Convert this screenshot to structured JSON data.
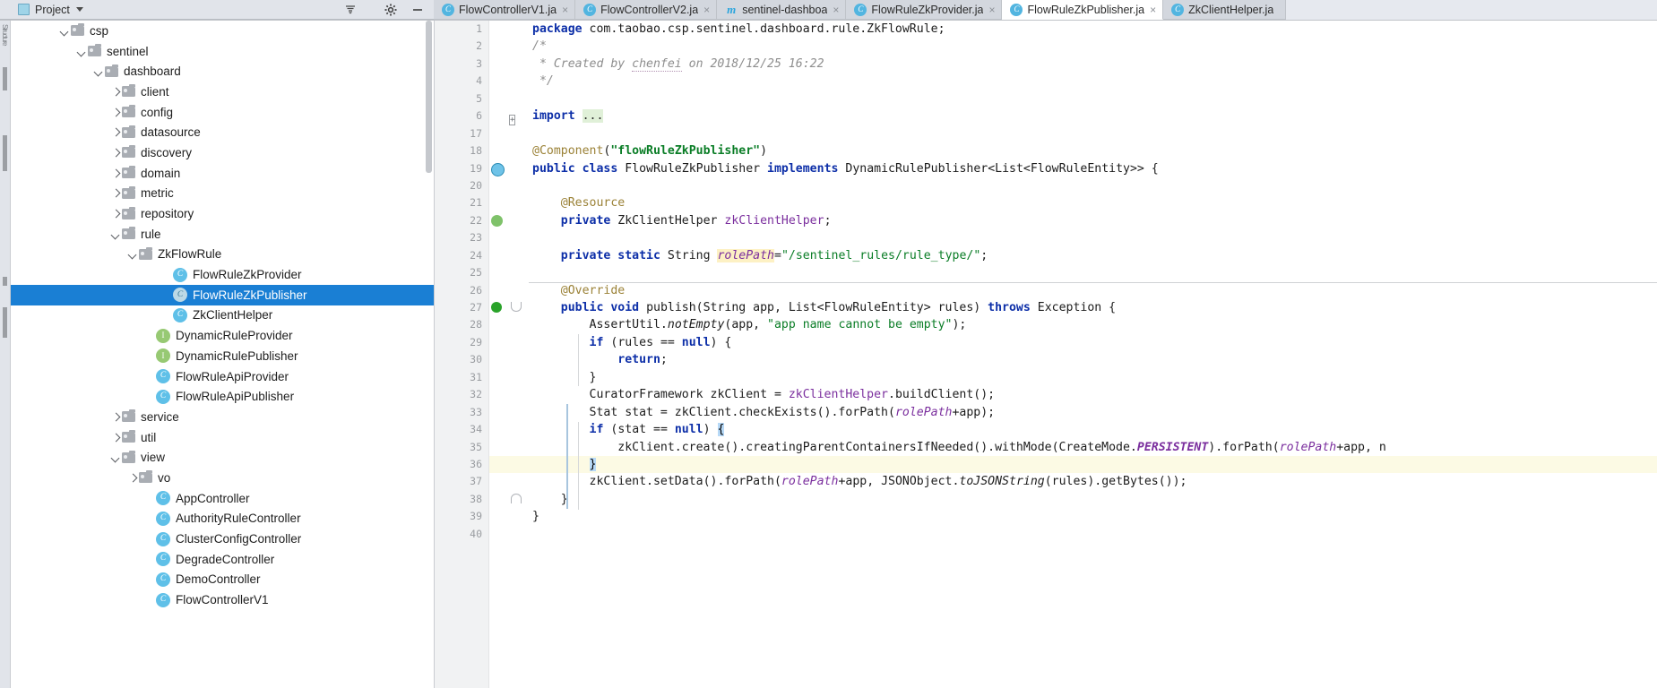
{
  "toolwindow": {
    "title": "Project",
    "icons": [
      "project-icon",
      "collapse-all-icon",
      "settings-gear-icon",
      "hide-icon"
    ],
    "dropdown_caret": "chevron-down-icon"
  },
  "tabs": [
    {
      "label": "FlowControllerV1.ja",
      "badge": "C",
      "badge_kind": "class",
      "active": false,
      "close": "×"
    },
    {
      "label": "FlowControllerV2.ja",
      "badge": "C",
      "badge_kind": "class",
      "active": false,
      "close": "×"
    },
    {
      "label": "sentinel-dashboa",
      "badge": "m",
      "badge_kind": "maven",
      "active": false,
      "close": "×"
    },
    {
      "label": "FlowRuleZkProvider.ja",
      "badge": "C",
      "badge_kind": "class",
      "active": false,
      "close": "×"
    },
    {
      "label": "FlowRuleZkPublisher.ja",
      "badge": "C",
      "badge_kind": "class",
      "active": true,
      "close": "×"
    },
    {
      "label": "ZkClientHelper.ja",
      "badge": "C",
      "badge_kind": "class",
      "active": false,
      "close": ""
    }
  ],
  "left_strip_label": "Structure",
  "tree": [
    {
      "label": "csp",
      "indent": 6,
      "arrow": "down",
      "icon": "folder"
    },
    {
      "label": "sentinel",
      "indent": 7,
      "arrow": "down",
      "icon": "folder"
    },
    {
      "label": "dashboard",
      "indent": 8,
      "arrow": "down",
      "icon": "folder"
    },
    {
      "label": "client",
      "indent": 9,
      "arrow": "right",
      "icon": "folder"
    },
    {
      "label": "config",
      "indent": 9,
      "arrow": "right",
      "icon": "folder"
    },
    {
      "label": "datasource",
      "indent": 9,
      "arrow": "right",
      "icon": "folder"
    },
    {
      "label": "discovery",
      "indent": 9,
      "arrow": "right",
      "icon": "folder"
    },
    {
      "label": "domain",
      "indent": 9,
      "arrow": "right",
      "icon": "folder"
    },
    {
      "label": "metric",
      "indent": 9,
      "arrow": "right",
      "icon": "folder"
    },
    {
      "label": "repository",
      "indent": 9,
      "arrow": "right",
      "icon": "folder"
    },
    {
      "label": "rule",
      "indent": 9,
      "arrow": "down",
      "icon": "folder"
    },
    {
      "label": "ZkFlowRule",
      "indent": 10,
      "arrow": "down",
      "icon": "folder"
    },
    {
      "label": "FlowRuleZkProvider",
      "indent": 12,
      "arrow": "none",
      "icon": "class"
    },
    {
      "label": "FlowRuleZkPublisher",
      "indent": 12,
      "arrow": "none",
      "icon": "class-selected",
      "selected": true
    },
    {
      "label": "ZkClientHelper",
      "indent": 12,
      "arrow": "none",
      "icon": "class"
    },
    {
      "label": "DynamicRuleProvider",
      "indent": 11,
      "arrow": "none",
      "icon": "interface"
    },
    {
      "label": "DynamicRulePublisher",
      "indent": 11,
      "arrow": "none",
      "icon": "interface"
    },
    {
      "label": "FlowRuleApiProvider",
      "indent": 11,
      "arrow": "none",
      "icon": "class"
    },
    {
      "label": "FlowRuleApiPublisher",
      "indent": 11,
      "arrow": "none",
      "icon": "class"
    },
    {
      "label": "service",
      "indent": 9,
      "arrow": "right",
      "icon": "folder"
    },
    {
      "label": "util",
      "indent": 9,
      "arrow": "right",
      "icon": "folder"
    },
    {
      "label": "view",
      "indent": 9,
      "arrow": "down",
      "icon": "folder"
    },
    {
      "label": "vo",
      "indent": 10,
      "arrow": "right",
      "icon": "folder"
    },
    {
      "label": "AppController",
      "indent": 11,
      "arrow": "none",
      "icon": "class"
    },
    {
      "label": "AuthorityRuleController",
      "indent": 11,
      "arrow": "none",
      "icon": "class"
    },
    {
      "label": "ClusterConfigController",
      "indent": 11,
      "arrow": "none",
      "icon": "class"
    },
    {
      "label": "DegradeController",
      "indent": 11,
      "arrow": "none",
      "icon": "class"
    },
    {
      "label": "DemoController",
      "indent": 11,
      "arrow": "none",
      "icon": "class"
    },
    {
      "label": "FlowControllerV1",
      "indent": 11,
      "arrow": "none",
      "icon": "class"
    }
  ],
  "editor": {
    "line_numbers": [
      "1",
      "2",
      "3",
      "4",
      "5",
      "6",
      "17",
      "18",
      "19",
      "20",
      "21",
      "22",
      "23",
      "24",
      "25",
      "26",
      "27",
      "28",
      "29",
      "30",
      "31",
      "32",
      "33",
      "34",
      "35",
      "36",
      "37",
      "38",
      "39",
      "40"
    ],
    "highlighted_line": "36",
    "gutter_icons": [
      {
        "line": "6",
        "name": "fold-expand-icon"
      },
      {
        "line": "19",
        "name": "implemented-interface-icon"
      },
      {
        "line": "22",
        "name": "bean-autowired-icon"
      },
      {
        "line": "27",
        "name": "override-method-icon"
      },
      {
        "line": "27",
        "name": "fold-collapse-icon"
      },
      {
        "line": "38",
        "name": "fold-collapse-icon"
      }
    ],
    "code_lines": [
      "package com.taobao.csp.sentinel.dashboard.rule.ZkFlowRule;",
      "/*",
      " * Created by chenfei on 2018/12/25 16:22",
      " */",
      "",
      "import ...",
      "",
      "@Component(\"flowRuleZkPublisher\")",
      "public class FlowRuleZkPublisher implements DynamicRulePublisher<List<FlowRuleEntity>> {",
      "",
      "    @Resource",
      "    private ZkClientHelper zkClientHelper;",
      "",
      "    private static String rolePath=\"/sentinel_rules/rule_type/\";",
      "",
      "    @Override",
      "    public void publish(String app, List<FlowRuleEntity> rules) throws Exception {",
      "        AssertUtil.notEmpty(app, \"app name cannot be empty\");",
      "        if (rules == null) {",
      "            return;",
      "        }",
      "        CuratorFramework zkClient = zkClientHelper.buildClient();",
      "        Stat stat = zkClient.checkExists().forPath(rolePath+app);",
      "        if (stat == null) {",
      "            zkClient.create().creatingParentContainersIfNeeded().withMode(CreateMode.PERSISTENT).forPath(rolePath+app, n",
      "        }",
      "        zkClient.setData().forPath(rolePath+app, JSONObject.toJSONString(rules).getBytes());",
      "    }",
      "}",
      ""
    ]
  },
  "colors": {
    "selection_blue": "#1a7fd4",
    "keyword_blue": "#0d2fa8",
    "string_green": "#0a7d26",
    "annotation_gold": "#9b8237",
    "field_purple": "#7b2f9e",
    "comment_gray": "#8e8e8e",
    "highlight_yellow": "#fcfae4",
    "class_icon_blue": "#5fc0e8",
    "interface_icon_green": "#97c973"
  }
}
